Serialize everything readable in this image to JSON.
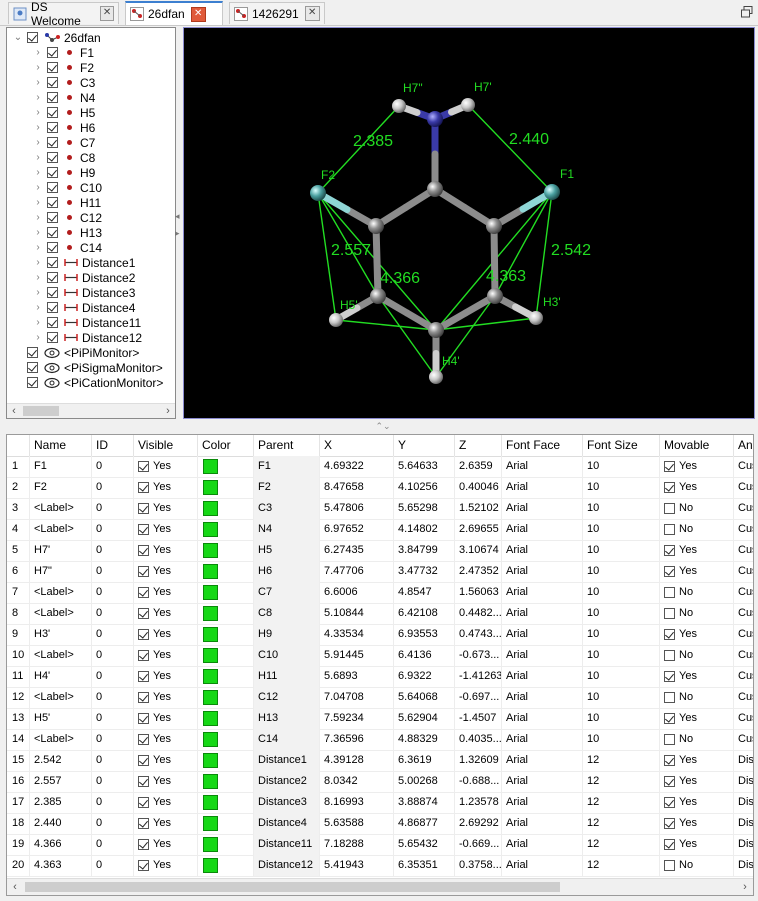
{
  "tabs": [
    {
      "label": "DS Welcome",
      "active": false
    },
    {
      "label": "26dfan",
      "active": true
    },
    {
      "label": "1426291",
      "active": false
    }
  ],
  "tree": {
    "root": "26dfan",
    "atoms": [
      "F1",
      "F2",
      "C3",
      "N4",
      "H5",
      "H6",
      "C7",
      "C8",
      "H9",
      "C10",
      "H11",
      "C12",
      "H13",
      "C14"
    ],
    "distances": [
      "Distance1",
      "Distance2",
      "Distance3",
      "Distance4",
      "Distance11",
      "Distance12"
    ],
    "monitors": [
      "<PiPiMonitor>",
      "<PiSigmaMonitor>",
      "<PiCationMonitor>"
    ]
  },
  "viewer": {
    "atom_labels": {
      "h7pp": "H7\"",
      "h7p": "H7'",
      "f2": "F2",
      "f1": "F1",
      "h5p": "H5'",
      "h3p": "H3'",
      "h4p": "H4'"
    },
    "distance_labels": {
      "d3": "2.385",
      "d4": "2.440",
      "d2": "2.557",
      "d1": "2.542",
      "d11": "4.366",
      "d12": "4.363"
    },
    "colors": {
      "carbon": "#909090",
      "nitrogen": "#3a3aa8",
      "fluorine": "#4aa0a0",
      "hydrogen": "#c8c8c8",
      "monitor": "#22dd22"
    }
  },
  "grid": {
    "columns": [
      "Name",
      "ID",
      "Visible",
      "Color",
      "Parent",
      "X",
      "Y",
      "Z",
      "Font Face",
      "Font Size",
      "Movable",
      "An"
    ],
    "rows": [
      {
        "n": "1",
        "name": "F1",
        "id": "0",
        "vis": "Yes",
        "parent": "F1",
        "x": "4.69322",
        "y": "5.64633",
        "z": "2.6359",
        "face": "Arial",
        "size": "10",
        "mov": "Yes",
        "movOn": true,
        "an": "Cus"
      },
      {
        "n": "2",
        "name": "F2",
        "id": "0",
        "vis": "Yes",
        "parent": "F2",
        "x": "8.47658",
        "y": "4.10256",
        "z": "0.40046",
        "face": "Arial",
        "size": "10",
        "mov": "Yes",
        "movOn": true,
        "an": "Cus"
      },
      {
        "n": "3",
        "name": "<Label>",
        "id": "0",
        "vis": "Yes",
        "parent": "C3",
        "x": "5.47806",
        "y": "5.65298",
        "z": "1.52102",
        "face": "Arial",
        "size": "10",
        "mov": "No",
        "movOn": false,
        "an": "Cus"
      },
      {
        "n": "4",
        "name": "<Label>",
        "id": "0",
        "vis": "Yes",
        "parent": "N4",
        "x": "6.97652",
        "y": "4.14802",
        "z": "2.69655",
        "face": "Arial",
        "size": "10",
        "mov": "No",
        "movOn": false,
        "an": "Cus"
      },
      {
        "n": "5",
        "name": "H7'",
        "id": "0",
        "vis": "Yes",
        "parent": "H5",
        "x": "6.27435",
        "y": "3.84799",
        "z": "3.10674",
        "face": "Arial",
        "size": "10",
        "mov": "Yes",
        "movOn": true,
        "an": "Cus"
      },
      {
        "n": "6",
        "name": "H7\"",
        "id": "0",
        "vis": "Yes",
        "parent": "H6",
        "x": "7.47706",
        "y": "3.47732",
        "z": "2.47352",
        "face": "Arial",
        "size": "10",
        "mov": "Yes",
        "movOn": true,
        "an": "Cus"
      },
      {
        "n": "7",
        "name": "<Label>",
        "id": "0",
        "vis": "Yes",
        "parent": "C7",
        "x": "6.6006",
        "y": "4.8547",
        "z": "1.56063",
        "face": "Arial",
        "size": "10",
        "mov": "No",
        "movOn": false,
        "an": "Cus"
      },
      {
        "n": "8",
        "name": "<Label>",
        "id": "0",
        "vis": "Yes",
        "parent": "C8",
        "x": "5.10844",
        "y": "6.42108",
        "z": "0.4482...",
        "face": "Arial",
        "size": "10",
        "mov": "No",
        "movOn": false,
        "an": "Cus"
      },
      {
        "n": "9",
        "name": "H3'",
        "id": "0",
        "vis": "Yes",
        "parent": "H9",
        "x": "4.33534",
        "y": "6.93553",
        "z": "0.4743...",
        "face": "Arial",
        "size": "10",
        "mov": "Yes",
        "movOn": true,
        "an": "Cus"
      },
      {
        "n": "10",
        "name": "<Label>",
        "id": "0",
        "vis": "Yes",
        "parent": "C10",
        "x": "5.91445",
        "y": "6.4136",
        "z": "-0.673...",
        "face": "Arial",
        "size": "10",
        "mov": "No",
        "movOn": false,
        "an": "Cus"
      },
      {
        "n": "11",
        "name": "H4'",
        "id": "0",
        "vis": "Yes",
        "parent": "H11",
        "x": "5.6893",
        "y": "6.9322",
        "z": "-1.41263",
        "face": "Arial",
        "size": "10",
        "mov": "Yes",
        "movOn": true,
        "an": "Cus"
      },
      {
        "n": "12",
        "name": "<Label>",
        "id": "0",
        "vis": "Yes",
        "parent": "C12",
        "x": "7.04708",
        "y": "5.64068",
        "z": "-0.697...",
        "face": "Arial",
        "size": "10",
        "mov": "No",
        "movOn": false,
        "an": "Cus"
      },
      {
        "n": "13",
        "name": "H5'",
        "id": "0",
        "vis": "Yes",
        "parent": "H13",
        "x": "7.59234",
        "y": "5.62904",
        "z": "-1.4507",
        "face": "Arial",
        "size": "10",
        "mov": "Yes",
        "movOn": true,
        "an": "Cus"
      },
      {
        "n": "14",
        "name": "<Label>",
        "id": "0",
        "vis": "Yes",
        "parent": "C14",
        "x": "7.36596",
        "y": "4.88329",
        "z": "0.4035...",
        "face": "Arial",
        "size": "10",
        "mov": "No",
        "movOn": false,
        "an": "Cus"
      },
      {
        "n": "15",
        "name": "2.542",
        "id": "0",
        "vis": "Yes",
        "parent": "Distance1",
        "x": "4.39128",
        "y": "6.3619",
        "z": "1.32609",
        "face": "Arial",
        "size": "12",
        "mov": "Yes",
        "movOn": true,
        "an": "Dist"
      },
      {
        "n": "16",
        "name": "2.557",
        "id": "0",
        "vis": "Yes",
        "parent": "Distance2",
        "x": "8.0342",
        "y": "5.00268",
        "z": "-0.688...",
        "face": "Arial",
        "size": "12",
        "mov": "Yes",
        "movOn": true,
        "an": "Dist"
      },
      {
        "n": "17",
        "name": "2.385",
        "id": "0",
        "vis": "Yes",
        "parent": "Distance3",
        "x": "8.16993",
        "y": "3.88874",
        "z": "1.23578",
        "face": "Arial",
        "size": "12",
        "mov": "Yes",
        "movOn": true,
        "an": "Dist"
      },
      {
        "n": "18",
        "name": "2.440",
        "id": "0",
        "vis": "Yes",
        "parent": "Distance4",
        "x": "5.63588",
        "y": "4.86877",
        "z": "2.69292",
        "face": "Arial",
        "size": "12",
        "mov": "Yes",
        "movOn": true,
        "an": "Dist"
      },
      {
        "n": "19",
        "name": "4.366",
        "id": "0",
        "vis": "Yes",
        "parent": "Distance11",
        "x": "7.18288",
        "y": "5.65432",
        "z": "-0.669...",
        "face": "Arial",
        "size": "12",
        "mov": "Yes",
        "movOn": true,
        "an": "Dist"
      },
      {
        "n": "20",
        "name": "4.363",
        "id": "0",
        "vis": "Yes",
        "parent": "Distance12",
        "x": "5.41943",
        "y": "6.35351",
        "z": "0.3758...",
        "face": "Arial",
        "size": "12",
        "mov": "No",
        "movOn": false,
        "an": "Dist"
      }
    ]
  }
}
